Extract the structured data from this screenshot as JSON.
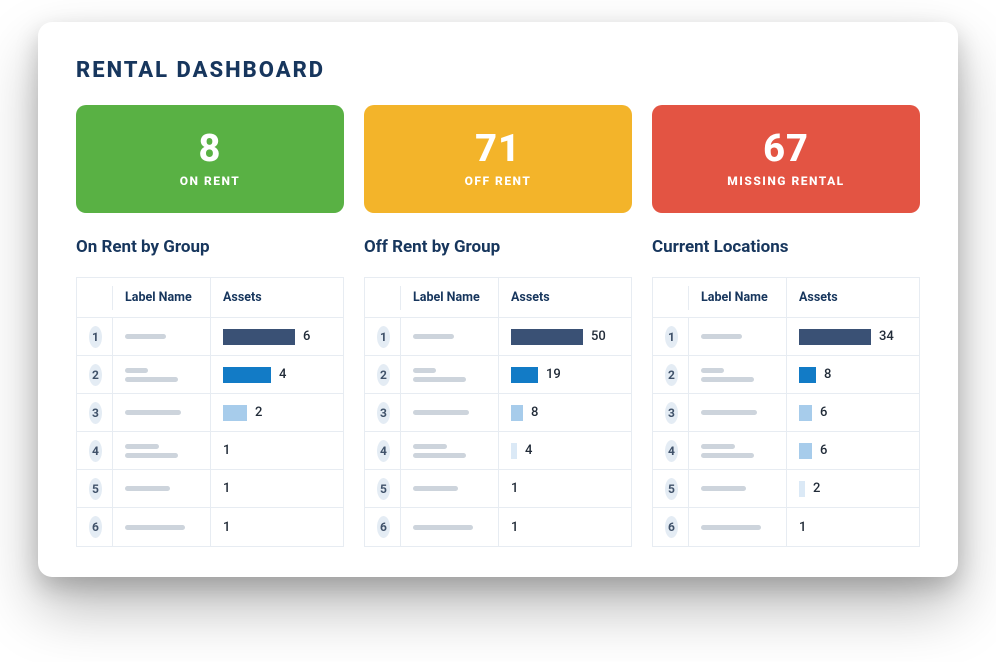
{
  "title": "RENTAL DASHBOARD",
  "kpis": [
    {
      "value": "8",
      "label": "ON RENT",
      "cls": "kpi-green"
    },
    {
      "value": "71",
      "label": "OFF RENT",
      "cls": "kpi-amber"
    },
    {
      "value": "67",
      "label": "MISSING RENTAL",
      "cls": "kpi-red"
    }
  ],
  "columns": {
    "label": "Label Name",
    "assets": "Assets"
  },
  "sections": [
    {
      "title": "On Rent by Group",
      "max": 6,
      "rows": [
        {
          "rank": "1",
          "value": 6,
          "bar": "bar1",
          "lblw": [
            55
          ]
        },
        {
          "rank": "2",
          "value": 4,
          "bar": "bar2",
          "lblw": [
            30,
            70
          ]
        },
        {
          "rank": "3",
          "value": 2,
          "bar": "bar3",
          "lblw": [
            75
          ]
        },
        {
          "rank": "4",
          "value": 1,
          "bar": "",
          "lblw": [
            45,
            70
          ]
        },
        {
          "rank": "5",
          "value": 1,
          "bar": "",
          "lblw": [
            60
          ]
        },
        {
          "rank": "6",
          "value": 1,
          "bar": "",
          "lblw": [
            80
          ]
        }
      ]
    },
    {
      "title": "Off Rent by Group",
      "max": 50,
      "rows": [
        {
          "rank": "1",
          "value": 50,
          "bar": "bar1",
          "lblw": [
            55
          ]
        },
        {
          "rank": "2",
          "value": 19,
          "bar": "bar2",
          "lblw": [
            30,
            70
          ]
        },
        {
          "rank": "3",
          "value": 8,
          "bar": "bar3",
          "lblw": [
            75
          ]
        },
        {
          "rank": "4",
          "value": 4,
          "bar": "bar4",
          "lblw": [
            45,
            70
          ]
        },
        {
          "rank": "5",
          "value": 1,
          "bar": "",
          "lblw": [
            60
          ]
        },
        {
          "rank": "6",
          "value": 1,
          "bar": "",
          "lblw": [
            80
          ]
        }
      ]
    },
    {
      "title": "Current Locations",
      "max": 34,
      "rows": [
        {
          "rank": "1",
          "value": 34,
          "bar": "bar1",
          "lblw": [
            55
          ]
        },
        {
          "rank": "2",
          "value": 8,
          "bar": "bar2",
          "lblw": [
            30,
            70
          ]
        },
        {
          "rank": "3",
          "value": 6,
          "bar": "bar3",
          "lblw": [
            75
          ]
        },
        {
          "rank": "4",
          "value": 6,
          "bar": "bar3",
          "lblw": [
            45,
            70
          ]
        },
        {
          "rank": "5",
          "value": 2,
          "bar": "bar4",
          "lblw": [
            60
          ]
        },
        {
          "rank": "6",
          "value": 1,
          "bar": "",
          "lblw": [
            80
          ]
        }
      ]
    }
  ],
  "chart_data": [
    {
      "type": "bar",
      "title": "On Rent by Group",
      "xlabel": "Label Name",
      "ylabel": "Assets",
      "categories": [
        "1",
        "2",
        "3",
        "4",
        "5",
        "6"
      ],
      "values": [
        6,
        4,
        2,
        1,
        1,
        1
      ]
    },
    {
      "type": "bar",
      "title": "Off Rent by Group",
      "xlabel": "Label Name",
      "ylabel": "Assets",
      "categories": [
        "1",
        "2",
        "3",
        "4",
        "5",
        "6"
      ],
      "values": [
        50,
        19,
        8,
        4,
        1,
        1
      ]
    },
    {
      "type": "bar",
      "title": "Current Locations",
      "xlabel": "Label Name",
      "ylabel": "Assets",
      "categories": [
        "1",
        "2",
        "3",
        "4",
        "5",
        "6"
      ],
      "values": [
        34,
        8,
        6,
        6,
        2,
        1
      ]
    }
  ]
}
